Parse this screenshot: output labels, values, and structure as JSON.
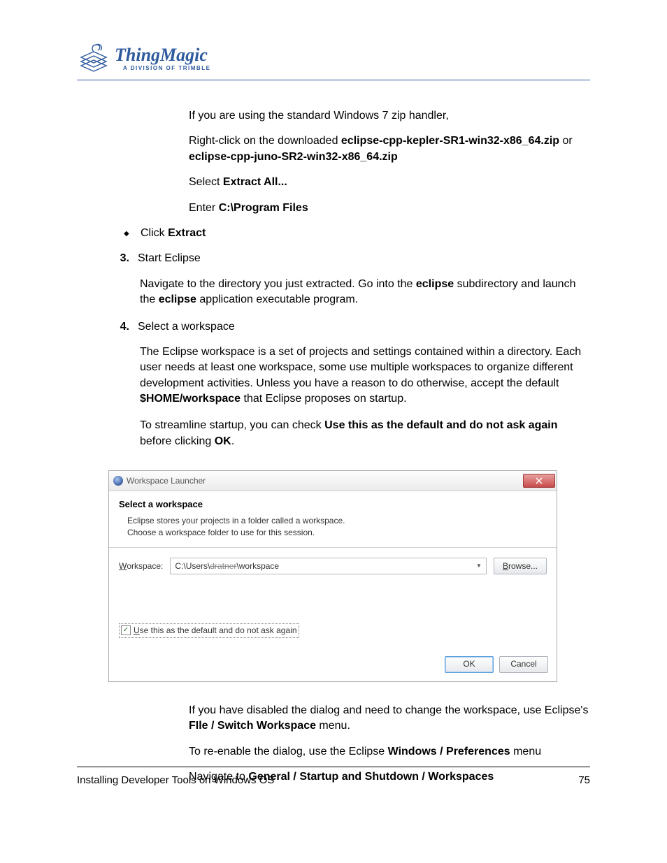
{
  "header": {
    "logo_name": "ThingMagic",
    "logo_sub": "A DIVISION OF TRIMBLE"
  },
  "body": {
    "intro_zip": "If you are using the standard Windows 7 zip handler,",
    "right_click_pre": "Right-click on the downloaded ",
    "zip1": "eclipse-cpp-kepler-SR1-win32-x86_64.zip",
    "or": " or ",
    "zip2": "eclipse-cpp-juno-SR2-win32-x86_64.zip",
    "select_extract_pre": "Select ",
    "select_extract_b": "Extract All...",
    "enter_pre": "Enter ",
    "enter_b": "C:\\Program Files",
    "bullet_click_pre": "Click ",
    "bullet_click_b": "Extract",
    "step3_num": "3.",
    "step3_title": "Start Eclipse",
    "step3_body_a": "Navigate to the directory you just extracted.  Go into the ",
    "step3_body_b1": "eclipse",
    "step3_body_c": " subdirectory and launch the ",
    "step3_body_b2": "eclipse",
    "step3_body_d": " application executable program.",
    "step4_num": "4.",
    "step4_title": "Select a workspace",
    "step4_p1_a": "The Eclipse workspace is a set of projects and settings contained within a directory. Each user needs at least one workspace, some use multiple workspaces to organize different development activities.  Unless you have a reason to do otherwise, accept the default ",
    "step4_p1_b": "$HOME/workspace",
    "step4_p1_c": " that Eclipse proposes on startup.",
    "step4_p2_a": "To streamline startup, you can check ",
    "step4_p2_b": "Use this as the default and do not ask again",
    "step4_p2_c": " before clicking ",
    "step4_p2_d": "OK",
    "step4_p2_e": ".",
    "after_p1_a": "If you have disabled the dialog and need to change the workspace, use Eclipse's ",
    "after_p1_b": "FIle / Switch Workspace",
    "after_p1_c": " menu.",
    "after_p2_a": "To re-enable the dialog, use the Eclipse ",
    "after_p2_b": "Windows / Preferences",
    "after_p2_c": " menu",
    "after_p3_a": "Navigate to ",
    "after_p3_b": "General / Startup and Shutdown / Workspaces"
  },
  "dialog": {
    "title": "Workspace Launcher",
    "heading": "Select a workspace",
    "desc1": "Eclipse stores your projects in a folder called a workspace.",
    "desc2": "Choose a workspace folder to use for this session.",
    "ws_label_u": "W",
    "ws_label_rest": "orkspace:",
    "ws_value_pre": "C:\\Users\\",
    "ws_value_strike": "dratner",
    "ws_value_post": "\\workspace",
    "browse_u": "B",
    "browse_rest": "rowse...",
    "check_u": "U",
    "check_rest": "se this as the default and do not ask again",
    "ok": "OK",
    "cancel": "Cancel"
  },
  "footer": {
    "left": "Installing Developer Tools on Windows OS",
    "right": "75"
  }
}
